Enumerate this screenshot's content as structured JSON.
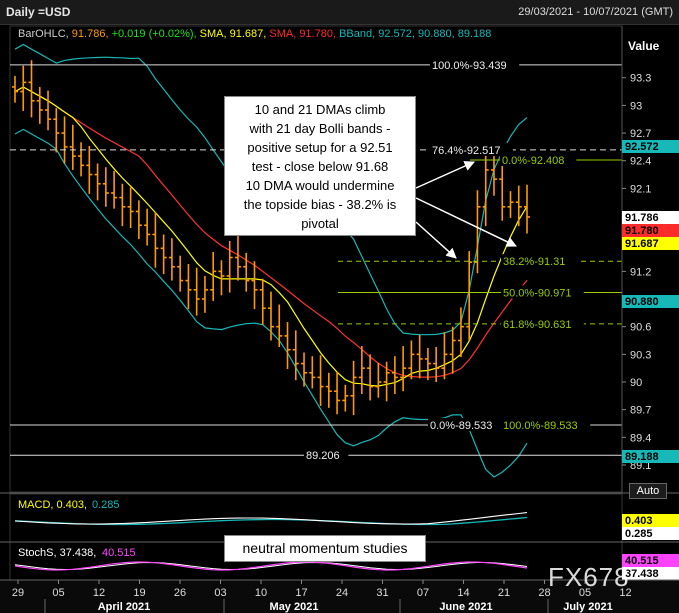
{
  "header": {
    "symbol": "Daily =USD",
    "range": "29/03/2021 - 10/07/2021 (GMT)"
  },
  "legend": {
    "study_name": "BarOHLC",
    "close": "91.786",
    "change": "+0.019",
    "change_pct": "(+0.02%)",
    "sma1_label": "SMA",
    "sma1_value": "91.687",
    "sma2_label": "SMA",
    "sma2_value": "91.780",
    "bband_label": "BBand",
    "bband_values": "92.572, 90.880, 89.188"
  },
  "value_axis": {
    "title": "Value",
    "ticks": [
      "93.3",
      "93",
      "92.7",
      "92.4",
      "92.1",
      "91.8",
      "91.2",
      "90.6",
      "90.3",
      "90",
      "89.7",
      "89.4",
      "89.1"
    ],
    "badges": [
      {
        "text": "92.572",
        "bg": "#16b8b8",
        "fg": "#000000"
      },
      {
        "text": "91.786",
        "bg": "#ffffff",
        "fg": "#000000"
      },
      {
        "text": "91.780",
        "bg": "#ff2a2a",
        "fg": "#000000"
      },
      {
        "text": "91.687",
        "bg": "#ffff00",
        "fg": "#000000"
      },
      {
        "text": "90.880",
        "bg": "#16b8b8",
        "fg": "#000000"
      },
      {
        "text": "89.188",
        "bg": "#16b8b8",
        "fg": "#000000"
      }
    ],
    "auto_label": "Auto"
  },
  "fib_levels": [
    {
      "label": "100.0%-93.439",
      "price": 93.439
    },
    {
      "label": "76.4%-92.517",
      "price": 92.517
    },
    {
      "label": "0.0%-92.408",
      "price": 92.408
    },
    {
      "label": "38.2%-91.31",
      "price": 91.31
    },
    {
      "label": "50.0%-90.971",
      "price": 90.971
    },
    {
      "label": "61.8%-90.631",
      "price": 90.631
    },
    {
      "label": "0.0%-89.533",
      "price": 89.533
    },
    {
      "label": "100.0%-89.533",
      "price": 89.533
    },
    {
      "label": "89.206",
      "price": 89.206
    }
  ],
  "callouts": {
    "main_lines": [
      "10 and 21 DMAs climb",
      "with 21 day Bolli bands -",
      "positive setup for a 92.51",
      "test - close below 91.68",
      "10 DMA would undermine",
      "the topside bias - 38.2% is",
      "pivotal"
    ],
    "momentum": "neutral momentum studies"
  },
  "macd": {
    "label": "MACD",
    "v1": "0.403",
    "v2": "0.285",
    "badges": [
      {
        "text": "0.403",
        "bg": "#ffff00",
        "fg": "#000000"
      },
      {
        "text": "0.285",
        "bg": "#ffffff",
        "fg": "#000000"
      }
    ]
  },
  "stoch": {
    "label": "StochS",
    "v1": "37.438",
    "v2": "40.515",
    "badges": [
      {
        "text": "40.515",
        "bg": "#ff44ff",
        "fg": "#000000"
      },
      {
        "text": "37.438",
        "bg": "#ffffff",
        "fg": "#000000"
      }
    ]
  },
  "date_axis": {
    "days": [
      "29",
      "05",
      "12",
      "19",
      "26",
      "03",
      "10",
      "17",
      "24",
      "31",
      "07",
      "14",
      "21",
      "28",
      "05",
      "12"
    ],
    "months": [
      "April 2021",
      "May 2021",
      "June 2021",
      "July 2021"
    ]
  },
  "watermark": "FX678",
  "colors": {
    "bars": "#ff9900",
    "sma10": "#ffff00",
    "sma21": "#ff2a2a",
    "bband": "#16b8b8",
    "fib": "#99cc00",
    "stoch_k": "#ff44ff",
    "macd": "#ffff00",
    "macd_signal": "#16b8b8"
  },
  "chart_data": {
    "type": "ohlc",
    "bars_approx_close": [
      93.15,
      93.25,
      93.05,
      92.95,
      92.85,
      92.7,
      92.55,
      92.45,
      92.35,
      92.25,
      92.15,
      92.05,
      92.0,
      91.9,
      91.85,
      91.7,
      91.6,
      91.45,
      91.35,
      91.25,
      91.1,
      91.0,
      90.9,
      91.0,
      91.2,
      91.15,
      91.35,
      91.25,
      91.1,
      91.0,
      90.8,
      90.6,
      90.5,
      90.35,
      90.2,
      90.1,
      90.05,
      89.95,
      89.9,
      89.8,
      89.85,
      90.05,
      90.15,
      89.95,
      90.0,
      90.1,
      90.05,
      90.15,
      90.3,
      90.25,
      90.2,
      90.15,
      90.3,
      90.45,
      90.6,
      91.3,
      91.9,
      92.3,
      92.2,
      91.9,
      91.95,
      91.9,
      91.79
    ],
    "sma10_last": 91.687,
    "sma21_last": 91.78,
    "bband_last": [
      92.572,
      90.88,
      89.188
    ]
  }
}
